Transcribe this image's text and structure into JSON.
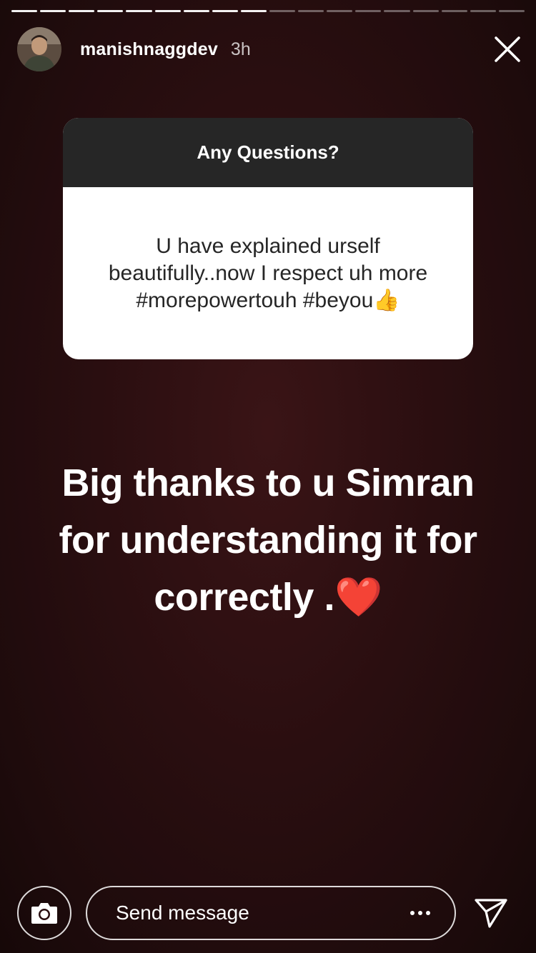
{
  "story": {
    "progress": {
      "segments_total": 18,
      "segments_completed": 9
    },
    "header": {
      "username": "manishnaggdev",
      "time_ago": "3h",
      "avatar_icon": "profile-photo",
      "close_icon": "close-icon"
    },
    "question_sticker": {
      "prompt": "Any Questions?",
      "answer_lines": [
        "U have explained urself",
        "beautifully..now I respect uh more",
        "#morepowertouh #beyou👍"
      ]
    },
    "caption": {
      "lines": [
        "Big thanks to u Simran",
        "for understanding it for",
        "correctly .❤️"
      ]
    },
    "footer": {
      "camera_icon": "camera-icon",
      "message_placeholder": "Send message",
      "more_icon": "more-dots-icon",
      "send_icon": "send-icon"
    }
  },
  "colors": {
    "background": "#2a0e10",
    "sticker_header": "#262626",
    "sticker_body": "#ffffff",
    "text_primary": "#ffffff"
  }
}
